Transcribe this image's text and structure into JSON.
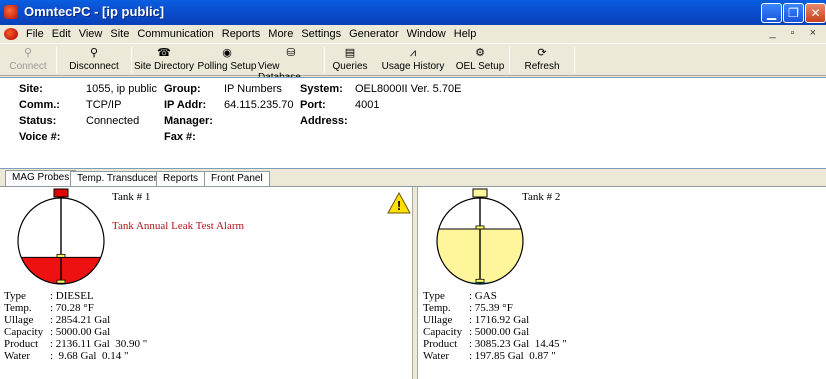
{
  "window": {
    "title": "OmntecPC - [ip public]"
  },
  "menu": {
    "items": [
      "File",
      "Edit",
      "View",
      "Site",
      "Communication",
      "Reports",
      "More",
      "Settings",
      "Generator",
      "Window",
      "Help"
    ]
  },
  "toolbar": {
    "connect": "Connect",
    "disconnect": "Disconnect",
    "site_directory": "Site Directory",
    "polling_setup": "Polling Setup",
    "view_database": "View Database",
    "queries": "Queries",
    "usage_history": "Usage History",
    "oel_setup": "OEL Setup",
    "refresh": "Refresh"
  },
  "site_info": {
    "site_label": "Site:",
    "site_value": "1055, ip public",
    "comm_label": "Comm.:",
    "comm_value": "TCP/IP",
    "status_label": "Status:",
    "status_value": "Connected",
    "voice_label": "Voice #:",
    "voice_value": "",
    "group_label": "Group:",
    "group_value": "IP Numbers",
    "ipaddr_label": "IP Addr:",
    "ipaddr_value": "64.115.235.70",
    "manager_label": "Manager:",
    "manager_value": "",
    "fax_label": "Fax #:",
    "fax_value": "",
    "system_label": "System:",
    "system_value": "OEL8000II Ver. 5.70E",
    "port_label": "Port:",
    "port_value": "4001",
    "address_label": "Address:",
    "address_value": ""
  },
  "tabs": [
    "MAG Probes",
    "Temp. Transducers",
    "Reports",
    "Front Panel"
  ],
  "active_tab": "MAG Probes",
  "tanks": [
    {
      "title": "Tank # 1",
      "alarm": "Tank Annual Leak Test Alarm",
      "fill_color": "#ee1111",
      "product_level_fraction": 0.31,
      "water_level_fraction": 0.01,
      "rows": [
        {
          "k": "Type",
          "v": ": DIESEL"
        },
        {
          "k": "Temp.",
          "v": ": 70.28 °F"
        },
        {
          "k": "Ullage",
          "v": ": 2854.21 Gal"
        },
        {
          "k": "Capacity",
          "v": ": 5000.00 Gal"
        },
        {
          "k": "Product",
          "v": ": 2136.11 Gal  30.90 \""
        },
        {
          "k": "Water",
          "v": ":  9.68 Gal  0.14 \""
        }
      ]
    },
    {
      "title": "Tank # 2",
      "alarm": "",
      "fill_color": "#fff59a",
      "product_level_fraction": 0.64,
      "water_level_fraction": 0.02,
      "rows": [
        {
          "k": "Type",
          "v": ": GAS"
        },
        {
          "k": "Temp.",
          "v": ": 75.39 °F"
        },
        {
          "k": "Ullage",
          "v": ": 1716.92 Gal"
        },
        {
          "k": "Capacity",
          "v": ": 5000.00 Gal"
        },
        {
          "k": "Product",
          "v": ": 3085.23 Gal  14.45 \""
        },
        {
          "k": "Water",
          "v": ": 197.85 Gal  0.87 \""
        }
      ]
    }
  ]
}
